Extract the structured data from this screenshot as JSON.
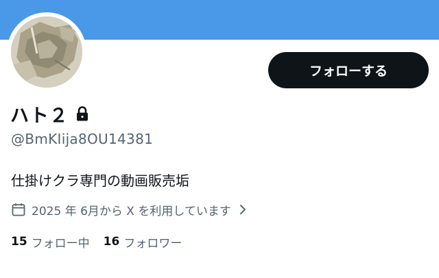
{
  "profile": {
    "display_name": "ハト２",
    "handle": "@BmKIija8OU14381",
    "bio": "仕掛けクラ専門の動画販売垢",
    "joined": "2025 年 6月から X を利用しています",
    "follow_label": "フォローする",
    "protected_icon": "lock-icon",
    "joined_icon": "calendar-icon"
  },
  "stats": {
    "following_count": "15",
    "following_label": "フォロー中",
    "followers_count": "16",
    "followers_label": "フォロワー"
  },
  "colors": {
    "banner": "#4a99e9",
    "button_bg": "#0f1419",
    "text_primary": "#0f1419",
    "text_secondary": "#536471"
  }
}
